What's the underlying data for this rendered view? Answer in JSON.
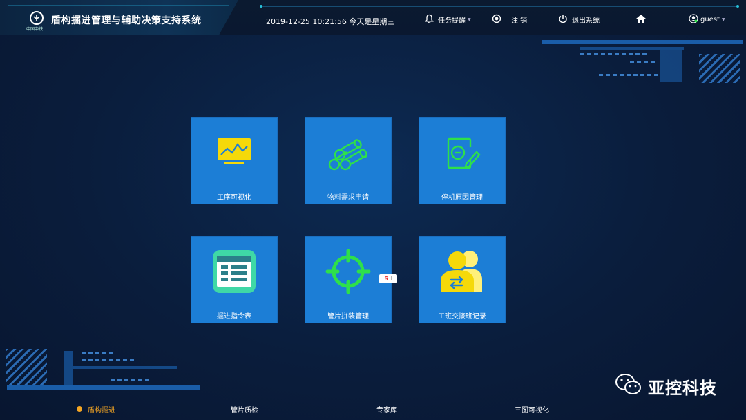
{
  "header": {
    "logo_sub": "中国中铁",
    "title": "盾构掘进管理与辅助决策支持系统",
    "datetime": "2019-12-25  10:21:56  今天是星期三",
    "task_reminder": "任务提醒",
    "logout_short": "注 销",
    "exit_system": "退出系统",
    "user": "guest"
  },
  "tiles": [
    {
      "label": "工序可视化",
      "icon": "monitor-chart-icon"
    },
    {
      "label": "物料需求申请",
      "icon": "pipes-icon"
    },
    {
      "label": "停机原因管理",
      "icon": "edit-form-icon"
    },
    {
      "label": "掘进指令表",
      "icon": "table-icon"
    },
    {
      "label": "管片拼装管理",
      "icon": "target-icon"
    },
    {
      "label": "工班交接班记录",
      "icon": "shift-exchange-icon"
    }
  ],
  "bottom_nav": [
    {
      "label": "盾构掘进",
      "active": true
    },
    {
      "label": "管片质检",
      "active": false
    },
    {
      "label": "专家库",
      "active": false
    },
    {
      "label": "三图可视化",
      "active": false
    }
  ],
  "widget": {
    "glyph": "S"
  },
  "watermark": "亚控科技",
  "colors": {
    "tile": "#1c7ed6",
    "accent": "#f5a623",
    "icon_green": "#2ee04a",
    "icon_yellow": "#f5d90a"
  }
}
